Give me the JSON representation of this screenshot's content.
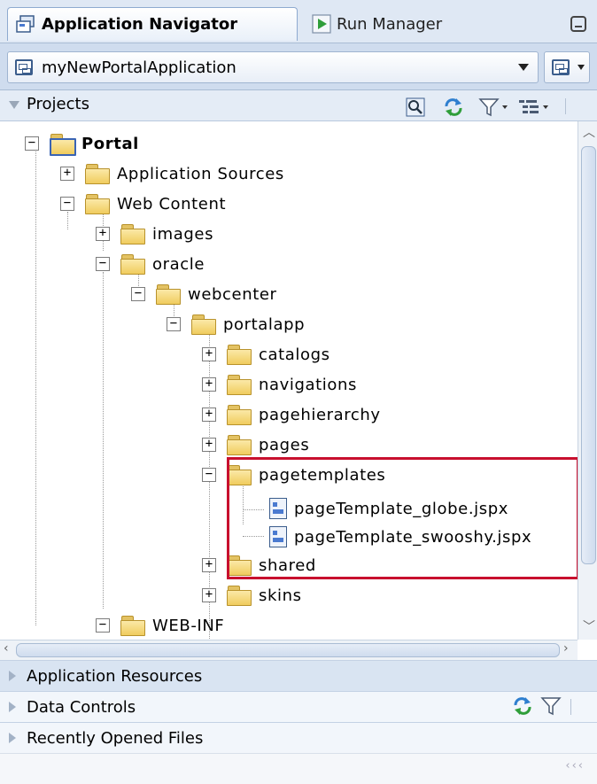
{
  "tabs": {
    "active_label": "Application Navigator",
    "inactive_label": "Run Manager"
  },
  "app_selector": {
    "value": "myNewPortalApplication"
  },
  "projects": {
    "label": "Projects"
  },
  "tree": {
    "portal": "Portal",
    "application_sources": "Application Sources",
    "web_content": "Web Content",
    "images": "images",
    "oracle": "oracle",
    "webcenter": "webcenter",
    "portalapp": "portalapp",
    "catalogs": "catalogs",
    "navigations": "navigations",
    "pagehierarchy": "pagehierarchy",
    "pages": "pages",
    "pagetemplates": "pagetemplates",
    "file_globe": "pageTemplate_globe.jspx",
    "file_swooshy": "pageTemplate_swooshy.jspx",
    "shared": "shared",
    "skins": "skins",
    "web_inf": "WEB-INF"
  },
  "accordion": {
    "application_resources": "Application Resources",
    "data_controls": "Data Controls",
    "recently_opened_files": "Recently Opened Files"
  },
  "colors": {
    "highlight_box": "#c8102e",
    "panel_header": "#dfe8f4",
    "folder": "#f0cc5e"
  }
}
